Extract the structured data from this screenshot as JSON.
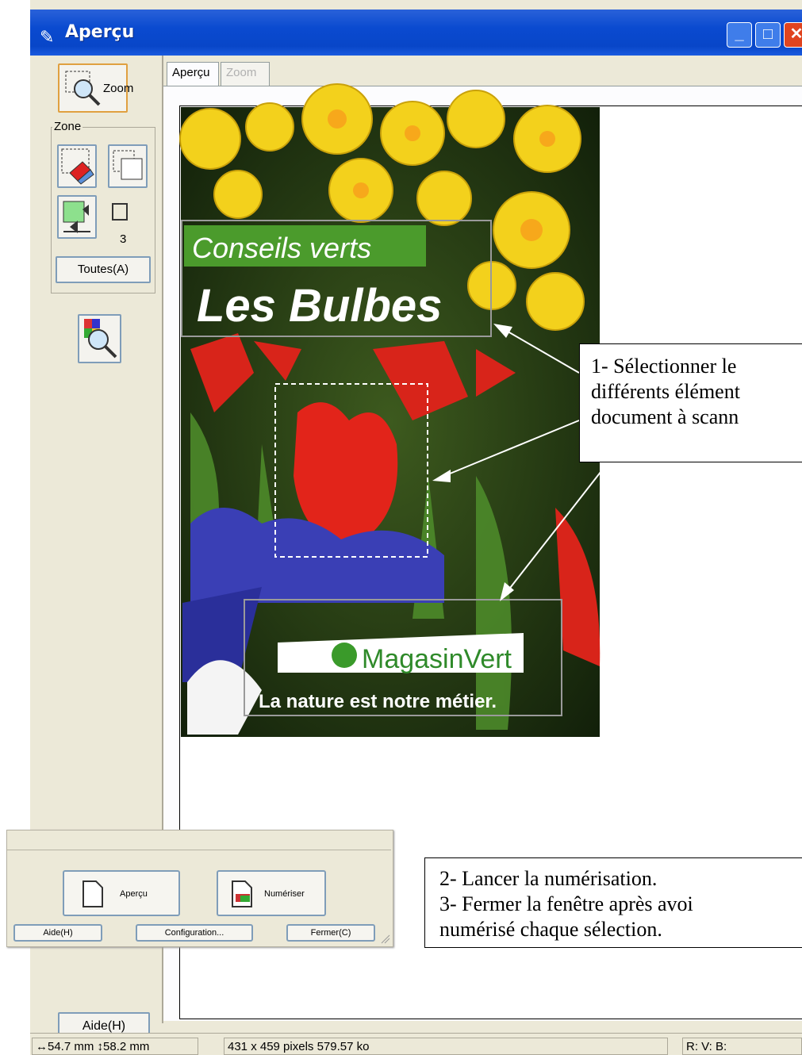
{
  "window": {
    "title": "Aperçu",
    "controls": [
      "minimize",
      "maximize",
      "close"
    ]
  },
  "toolbar": {
    "zoom_label": "Zoom",
    "zone_label": "Zone",
    "count": "3",
    "toutes_label": "Toutes(A)",
    "aide_label": "Aide(H)"
  },
  "tabs": [
    {
      "label": "Aperçu",
      "active": true
    },
    {
      "label": "Zoom",
      "active": false
    }
  ],
  "preview": {
    "title_green": "Conseils verts",
    "title_main": "Les Bulbes",
    "brand": "MagasinVert",
    "slogan": "La nature est notre métier."
  },
  "callouts": {
    "step1": [
      "1- Sélectionner le",
      "différents élément",
      "document à scann"
    ],
    "step2": "2- Lancer la numérisation.",
    "step3": [
      "3- Fermer la fenêtre après avoi",
      "numérisé chaque sélection."
    ]
  },
  "inset": {
    "apercu_label": "Aperçu",
    "numeriser_label": "Numériser",
    "aide_label": "Aide(H)",
    "config_label": "Configuration...",
    "fermer_label": "Fermer(C)"
  },
  "statusbar": {
    "width": "54.7 mm",
    "height": "58.2 mm",
    "pixels": "431 x 459 pixels 579.57 ko",
    "rgb": "R: V: B:"
  },
  "colors": {
    "titlebar": "#0a4ad0",
    "window_bg": "#ece9d8",
    "close": "#e0441f",
    "brand_green": "#2f8a2a"
  }
}
